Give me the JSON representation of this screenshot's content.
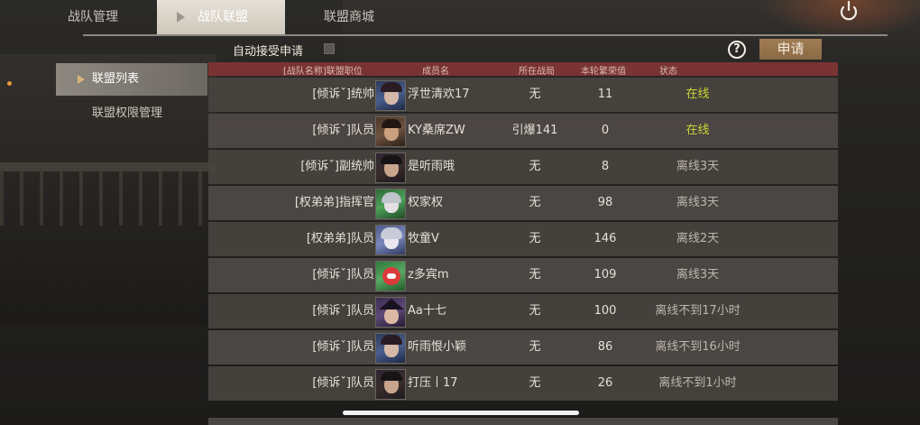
{
  "tabs": [
    {
      "label": "战队管理"
    },
    {
      "label": "战队联盟"
    },
    {
      "label": "联盟商城"
    }
  ],
  "toolbar": {
    "auto_accept_label": "自动接受申请",
    "auto_accept_checked": false,
    "help_label": "?",
    "apply_label": "申请"
  },
  "sidebar": {
    "items": [
      {
        "label": "联盟列表"
      },
      {
        "label": "联盟权限管理"
      }
    ]
  },
  "table": {
    "headers": {
      "position": "[战队名称]联盟职位",
      "member": "成员名",
      "battlefield": "所在战局",
      "prosperity": "本轮繁荣值",
      "status": "状态"
    },
    "rows": [
      {
        "position": "[倾诉ˇ]统帅",
        "name": "浮世清欢17",
        "battlefield": "无",
        "value": "11",
        "status": "在线",
        "online": true,
        "avatar": "av-blue"
      },
      {
        "position": "[倾诉ˇ]队员",
        "name": "KY桑席ZW",
        "battlefield": "引爆141",
        "value": "0",
        "status": "在线",
        "online": true,
        "avatar": "av-brown"
      },
      {
        "position": "[倾诉ˇ]副统帅",
        "name": "是听雨哦",
        "battlefield": "无",
        "value": "8",
        "status": "离线3天",
        "online": false,
        "avatar": "av-dark"
      },
      {
        "position": "[权弟弟]指挥官",
        "name": "权家权",
        "battlefield": "无",
        "value": "98",
        "status": "离线3天",
        "online": false,
        "avatar": "av-green"
      },
      {
        "position": "[权弟弟]队员",
        "name": "牧童V",
        "battlefield": "无",
        "value": "146",
        "status": "离线2天",
        "online": false,
        "avatar": "av-silver"
      },
      {
        "position": "[倾诉ˇ]队员",
        "name": "z多宾m",
        "battlefield": "无",
        "value": "109",
        "status": "离线3天",
        "online": false,
        "avatar": "av-red"
      },
      {
        "position": "[倾诉ˇ]队员",
        "name": "Aa十七",
        "battlefield": "无",
        "value": "100",
        "status": "离线不到17小时",
        "online": false,
        "avatar": "av-witch"
      },
      {
        "position": "[倾诉ˇ]队员",
        "name": "听雨恨小颖",
        "battlefield": "无",
        "value": "86",
        "status": "离线不到16小时",
        "online": false,
        "avatar": "av-blue"
      },
      {
        "position": "[倾诉ˇ]队员",
        "name": "打压丨17",
        "battlefield": "无",
        "value": "26",
        "status": "离线不到1小时",
        "online": false,
        "avatar": "av-dark"
      }
    ]
  },
  "colors": {
    "online": "#c7d437",
    "offline": "#bdb6ab",
    "header_bg": "#7a3333",
    "apply_button": "#a07c53"
  },
  "icons": {
    "power": "power-icon",
    "help": "help-icon",
    "tab_arrow": "triangle-right-icon"
  }
}
